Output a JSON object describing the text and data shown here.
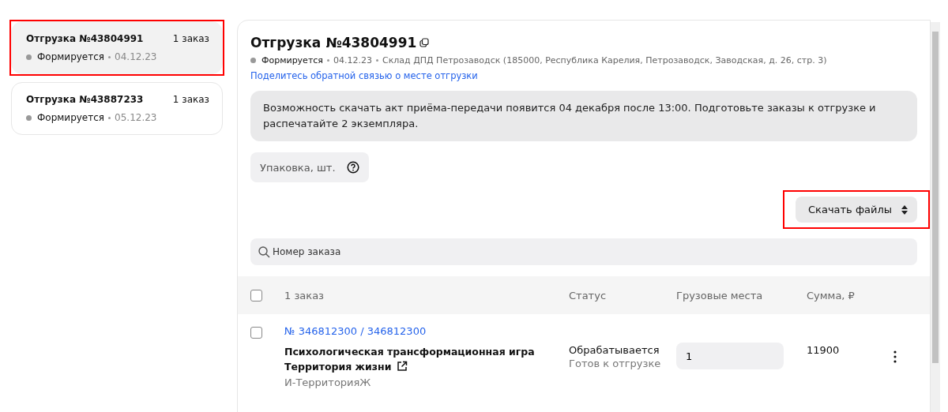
{
  "shipments": [
    {
      "title": "Отгрузка №43804991",
      "count": "1 заказ",
      "status": "Формируется",
      "date": "04.12.23",
      "selected": true,
      "highlighted": true
    },
    {
      "title": "Отгрузка №43887233",
      "count": "1 заказ",
      "status": "Формируется",
      "date": "05.12.23",
      "selected": false,
      "highlighted": false
    }
  ],
  "detail": {
    "title": "Отгрузка №43804991",
    "status": "Формируется",
    "date": "04.12.23",
    "warehouse": "Склад ДПД Петрозаводск (185000, Республика Карелия, Петрозаводск, Заводская, д. 26, стр. 3)",
    "feedback_link": "Поделитесь обратной связью о месте отгрузки",
    "notice": "Возможность скачать акт приёма-передачи появится 04 декабря после 13:00. Подготовьте заказы к отгрузке и распечатайте 2 экземпляра.",
    "packaging_label": "Упаковка, шт.",
    "download_button": {
      "label": "Скачать файлы",
      "highlighted": true
    },
    "search": {
      "placeholder": "Номер заказа"
    }
  },
  "table": {
    "columns": [
      "1 заказ",
      "Статус",
      "Грузовые места",
      "Сумма, ₽"
    ],
    "header_checked": false,
    "rows": [
      {
        "checked": false,
        "order_link": "№ 346812300 / 346812300",
        "product_name": "Психологическая трансформационная игра Территория жизни",
        "seller": "И-ТерриторияЖ",
        "status": "Обрабатывается",
        "substatus": "Готов к отгрузке",
        "cargo_places": "1",
        "sum": "11900"
      }
    ]
  }
}
